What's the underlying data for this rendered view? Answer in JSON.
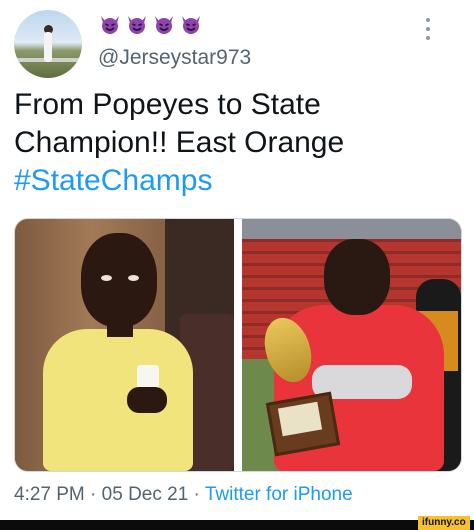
{
  "tweet": {
    "emojis": [
      "smiling-devil-emoji",
      "smiling-devil-emoji",
      "smiling-devil-emoji",
      "smiling-devil-emoji"
    ],
    "handle": "@Jerseystar973",
    "text_line1": "From Popeyes to State",
    "text_line2": "Champion!! East Orange",
    "hashtag": "#StateChamps",
    "time": "4:27 PM",
    "sep1": " · ",
    "date": "05 Dec 21",
    "sep2": " · ",
    "source": "Twitter for iPhone"
  },
  "watermark": {
    "label": "ifunny.co"
  },
  "colors": {
    "link": "#1d9bf0",
    "secondary_text": "#536471",
    "emoji": "#8e44ad"
  },
  "icons": {
    "more": "more-vertical-icon",
    "avatar": "avatar"
  }
}
